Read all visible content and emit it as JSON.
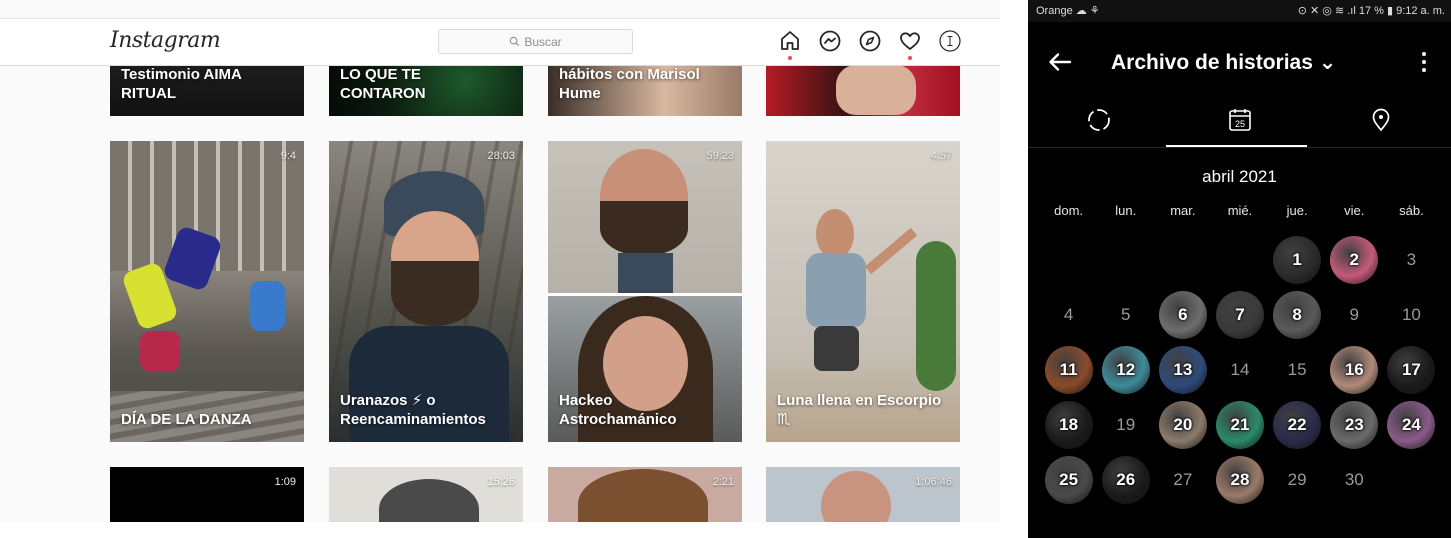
{
  "web": {
    "logo": "Instagram",
    "search_placeholder": "Buscar",
    "nav_icons": [
      "home-icon",
      "messenger-icon",
      "explore-icon",
      "heart-icon",
      "profile-avatar"
    ],
    "top_row": [
      {
        "label": "Testimonio AIMA RITUAL"
      },
      {
        "label": "LO QUE TE CONTARON"
      },
      {
        "label": "hábitos con Marisol Hume"
      },
      {
        "label": ""
      }
    ],
    "middle_row": [
      {
        "label": "DÍA DE LA DANZA",
        "duration": "9:4"
      },
      {
        "label": "Uranazos ⚡ o Reencaminamientos",
        "duration": "28:03"
      },
      {
        "label": "Hackeo Astrochamánico",
        "duration": "59:23"
      },
      {
        "label": "Luna llena en Escorpio ♏",
        "duration": "4:57"
      }
    ],
    "bottom_row": [
      {
        "duration": "1:09"
      },
      {
        "duration": "15:26"
      },
      {
        "duration": "2:21"
      },
      {
        "duration": "1:06:46"
      }
    ]
  },
  "phone": {
    "status_left": "Orange ☁ ⚘",
    "status_right": "⊙ ✕ ◎ ≋ .ıl 17 % ▮ 9:12 a. m.",
    "title": "Archivo de historias ⌄",
    "tabs": [
      "stories-circle-icon",
      "calendar-icon",
      "location-pin-icon"
    ],
    "calendar_day_badge": "25",
    "month": "abril 2021",
    "weekdays": [
      "dom.",
      "lun.",
      "mar.",
      "mié.",
      "jue.",
      "vie.",
      "sáb."
    ],
    "leading_blanks": 4,
    "days": [
      {
        "n": "1",
        "story": true,
        "color": "#2a2a2a"
      },
      {
        "n": "2",
        "story": true,
        "color": "#c45a7a"
      },
      {
        "n": "3",
        "story": false
      },
      {
        "n": "4",
        "story": false
      },
      {
        "n": "5",
        "story": false
      },
      {
        "n": "6",
        "story": true,
        "color": "#6d6d6d"
      },
      {
        "n": "7",
        "story": true,
        "color": "#3a3a3a"
      },
      {
        "n": "8",
        "story": true,
        "color": "#5a5a5a"
      },
      {
        "n": "9",
        "story": false
      },
      {
        "n": "10",
        "story": false
      },
      {
        "n": "11",
        "story": true,
        "color": "#8a4a2a"
      },
      {
        "n": "12",
        "story": true,
        "color": "#3f8a9a"
      },
      {
        "n": "13",
        "story": true,
        "color": "#2e4a7a"
      },
      {
        "n": "14",
        "story": false
      },
      {
        "n": "15",
        "story": false
      },
      {
        "n": "16",
        "story": true,
        "color": "#b08a7a"
      },
      {
        "n": "17",
        "story": true,
        "color": "#1a1a1a"
      },
      {
        "n": "18",
        "story": true,
        "color": "#1a1a1a"
      },
      {
        "n": "19",
        "story": false
      },
      {
        "n": "20",
        "story": true,
        "color": "#8a7a6a"
      },
      {
        "n": "21",
        "story": true,
        "color": "#2a8a6a"
      },
      {
        "n": "22",
        "story": true,
        "color": "#2a2a4a"
      },
      {
        "n": "23",
        "story": true,
        "color": "#6a6a6a"
      },
      {
        "n": "24",
        "story": true,
        "color": "#8a5a8a"
      },
      {
        "n": "25",
        "story": true,
        "color": "#4a4a4a"
      },
      {
        "n": "26",
        "story": true,
        "color": "#1a1a1a"
      },
      {
        "n": "27",
        "story": false
      },
      {
        "n": "28",
        "story": true,
        "color": "#9a7a6a"
      },
      {
        "n": "29",
        "story": false
      },
      {
        "n": "30",
        "story": false
      }
    ]
  }
}
